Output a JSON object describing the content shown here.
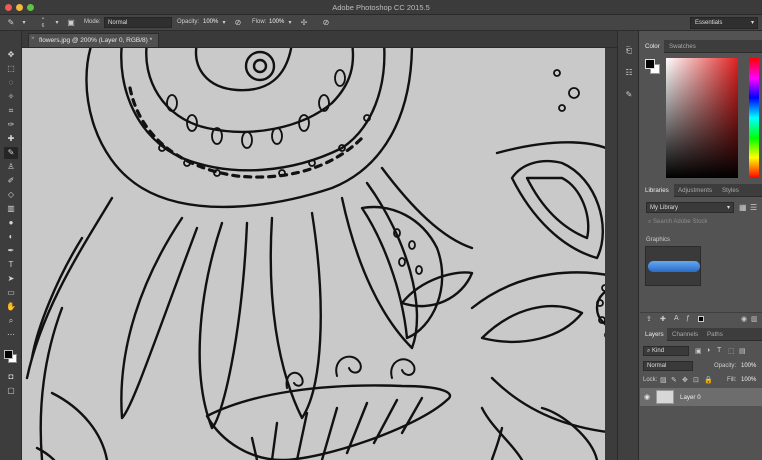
{
  "window": {
    "title": "Adobe Photoshop CC 2015.5"
  },
  "options_bar": {
    "mode_label": "Mode:",
    "mode_value": "Normal",
    "opacity_label": "Opacity:",
    "opacity_value": "100%",
    "flow_label": "Flow:",
    "flow_value": "100%",
    "brush_size": "6",
    "workspace": "Essentials"
  },
  "document": {
    "tab_label": "flowers.jpg @ 200% (Layer 0, RGB/8) *"
  },
  "panels": {
    "color": {
      "tabs": [
        "Color",
        "Swatches"
      ],
      "active_tab": "Color",
      "fg": "#000000",
      "bg": "#ffffff"
    },
    "libraries": {
      "tabs": [
        "Libraries",
        "Adjustments",
        "Styles"
      ],
      "library": "My Library",
      "search_placeholder": "Search Adobe Stock",
      "section": "Graphics"
    },
    "layers": {
      "tabs": [
        "Layers",
        "Channels",
        "Paths"
      ],
      "kind_filter": "Kind",
      "blend_mode": "Normal",
      "opacity_label": "Opacity:",
      "opacity_value": "100%",
      "lock_label": "Lock:",
      "fill_label": "Fill:",
      "fill_value": "100%",
      "items": [
        {
          "name": "Layer 0",
          "visible": true
        }
      ]
    }
  },
  "icons": {
    "tools": [
      "move-icon",
      "marquee-icon",
      "lasso-icon",
      "quick-select-icon",
      "crop-icon",
      "eyedropper-icon",
      "healing-icon",
      "brush-icon",
      "clone-stamp-icon",
      "history-brush-icon",
      "eraser-icon",
      "gradient-icon",
      "blur-icon",
      "dodge-icon",
      "pen-icon",
      "type-icon",
      "path-select-icon",
      "rectangle-icon",
      "hand-icon",
      "zoom-icon",
      "more-tools-icon"
    ]
  }
}
